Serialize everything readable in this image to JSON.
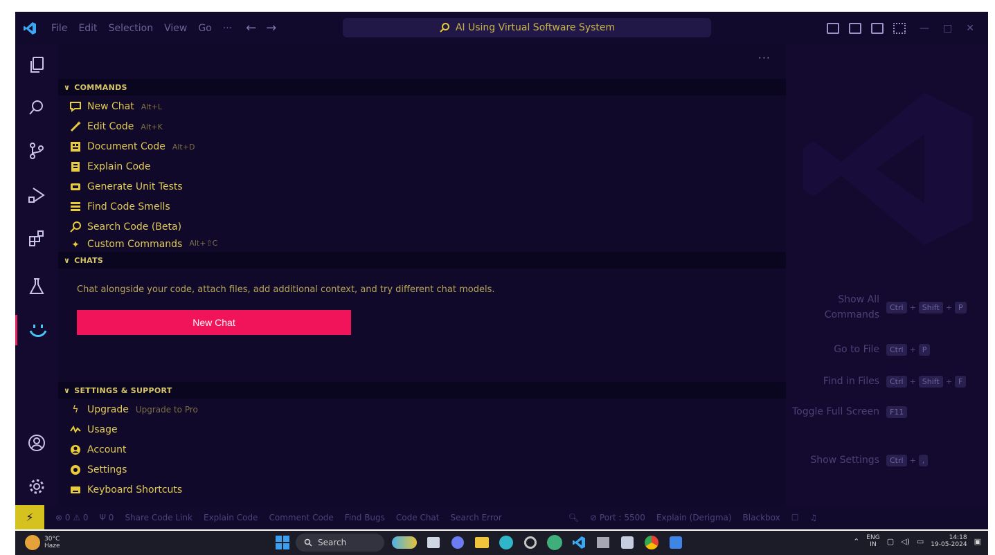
{
  "window": {
    "menu": [
      "File",
      "Edit",
      "Selection",
      "View",
      "Go",
      "···"
    ],
    "search_text": "AI Using Virtual Software System",
    "controls": [
      "—",
      "□",
      "✕"
    ]
  },
  "panel": {
    "more": "···",
    "commands": {
      "header": "COMMANDS",
      "items": [
        {
          "label": "New Chat",
          "shortcut": "Alt+L",
          "icon": "chat-bubble-icon"
        },
        {
          "label": "Edit Code",
          "shortcut": "Alt+K",
          "icon": "magic-wand-icon"
        },
        {
          "label": "Document Code",
          "shortcut": "Alt+D",
          "icon": "document-icon"
        },
        {
          "label": "Explain Code",
          "shortcut": "",
          "icon": "book-icon"
        },
        {
          "label": "Generate Unit Tests",
          "shortcut": "",
          "icon": "test-tube-icon"
        },
        {
          "label": "Find Code Smells",
          "shortcut": "",
          "icon": "list-icon"
        },
        {
          "label": "Search Code (Beta)",
          "shortcut": "",
          "icon": "search-icon"
        },
        {
          "label": "Custom Commands",
          "shortcut": "Alt+⇧C",
          "icon": "tool-icon"
        }
      ]
    },
    "chats": {
      "header": "CHATS",
      "description": "Chat alongside your code, attach files, add additional context, and try different chat models.",
      "button": "New Chat"
    },
    "settings": {
      "header": "SETTINGS & SUPPORT",
      "items": [
        {
          "label": "Upgrade",
          "hint": "Upgrade to Pro",
          "icon": "lightning-icon"
        },
        {
          "label": "Usage",
          "hint": "",
          "icon": "pulse-icon"
        },
        {
          "label": "Account",
          "hint": "",
          "icon": "account-icon"
        },
        {
          "label": "Settings",
          "hint": "",
          "icon": "gear-icon"
        },
        {
          "label": "Keyboard Shortcuts",
          "hint": "",
          "icon": "keyboard-icon"
        }
      ]
    }
  },
  "welcome": {
    "shortcuts": [
      {
        "label": "Show All Commands",
        "keys": [
          "Ctrl",
          "Shift",
          "P"
        ]
      },
      {
        "label": "Go to File",
        "keys": [
          "Ctrl",
          "P"
        ]
      },
      {
        "label": "Find in Files",
        "keys": [
          "Ctrl",
          "Shift",
          "F"
        ]
      },
      {
        "label": "Toggle Full Screen",
        "keys": [
          "F11"
        ]
      },
      {
        "label": "Show Settings",
        "keys": [
          "Ctrl",
          ","
        ]
      }
    ]
  },
  "statusbar": {
    "items": [
      "⊗ 0 ⚠ 0",
      "Ψ 0",
      "Share Code Link",
      "Explain Code",
      "Comment Code",
      "Find Bugs",
      "Code Chat",
      "Search Error"
    ],
    "right": [
      "⊘ Port : 5500",
      "Explain (Derigma)",
      "Blackbox"
    ]
  },
  "taskbar": {
    "weather_temp": "30°C",
    "weather_desc": "Haze",
    "search": "Search",
    "lang_top": "ENG",
    "lang_bottom": "IN",
    "time": "14:18",
    "date": "19-05-2024"
  },
  "colors": {
    "accent": "#f2145b",
    "text_yellow": "#e0cb55",
    "bg": "#14092f",
    "remote": "#d6c21f"
  }
}
